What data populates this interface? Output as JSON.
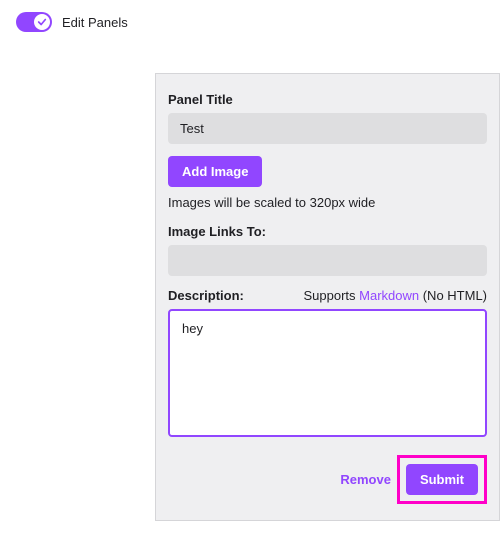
{
  "header": {
    "toggle_label": "Edit Panels"
  },
  "panel": {
    "title_label": "Panel Title",
    "title_value": "Test",
    "add_image_label": "Add Image",
    "image_hint": "Images will be scaled to 320px wide",
    "image_links_label": "Image Links To:",
    "image_links_value": "",
    "description_label": "Description:",
    "supports_prefix": "Supports ",
    "markdown_link": "Markdown",
    "supports_suffix": " (No HTML)",
    "description_value": "hey",
    "remove_label": "Remove",
    "submit_label": "Submit"
  },
  "colors": {
    "accent": "#9146FF",
    "highlight": "#ff00c8"
  }
}
